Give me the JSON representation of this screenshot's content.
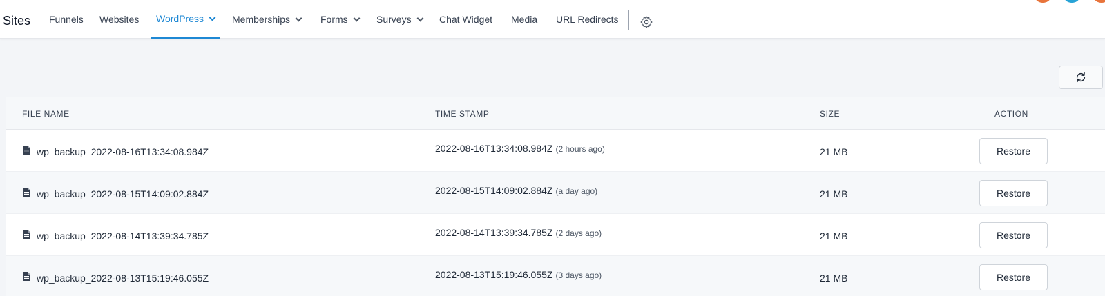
{
  "nav": {
    "brand": "Sites",
    "items": [
      {
        "label": "Funnels"
      },
      {
        "label": "Websites"
      },
      {
        "label": "WordPress"
      },
      {
        "label": "Memberships"
      },
      {
        "label": "Forms"
      },
      {
        "label": "Surveys"
      },
      {
        "label": "Chat Widget"
      },
      {
        "label": "Media"
      },
      {
        "label": "URL Redirects"
      }
    ],
    "active_item": "WordPress",
    "accent_color": "#1e88d4"
  },
  "icons": {
    "settings": "gear-icon",
    "refresh": "refresh-icon",
    "file": "file-icon"
  },
  "table": {
    "headers": {
      "file_name": "FILE NAME",
      "time_stamp": "TIME STAMP",
      "size": "SIZE",
      "action": "ACTION"
    },
    "rows": [
      {
        "file_name": "wp_backup_2022-08-16T13:34:08.984Z",
        "time_stamp": "2022-08-16T13:34:08.984Z",
        "relative_time": "(2 hours ago)",
        "size": "21 MB",
        "action_label": "Restore"
      },
      {
        "file_name": "wp_backup_2022-08-15T14:09:02.884Z",
        "time_stamp": "2022-08-15T14:09:02.884Z",
        "relative_time": "(a day ago)",
        "size": "21 MB",
        "action_label": "Restore"
      },
      {
        "file_name": "wp_backup_2022-08-14T13:39:34.785Z",
        "time_stamp": "2022-08-14T13:39:34.785Z",
        "relative_time": "(2 days ago)",
        "size": "21 MB",
        "action_label": "Restore"
      },
      {
        "file_name": "wp_backup_2022-08-13T15:19:46.055Z",
        "time_stamp": "2022-08-13T15:19:46.055Z",
        "relative_time": "(3 days ago)",
        "size": "21 MB",
        "action_label": "Restore"
      }
    ]
  }
}
